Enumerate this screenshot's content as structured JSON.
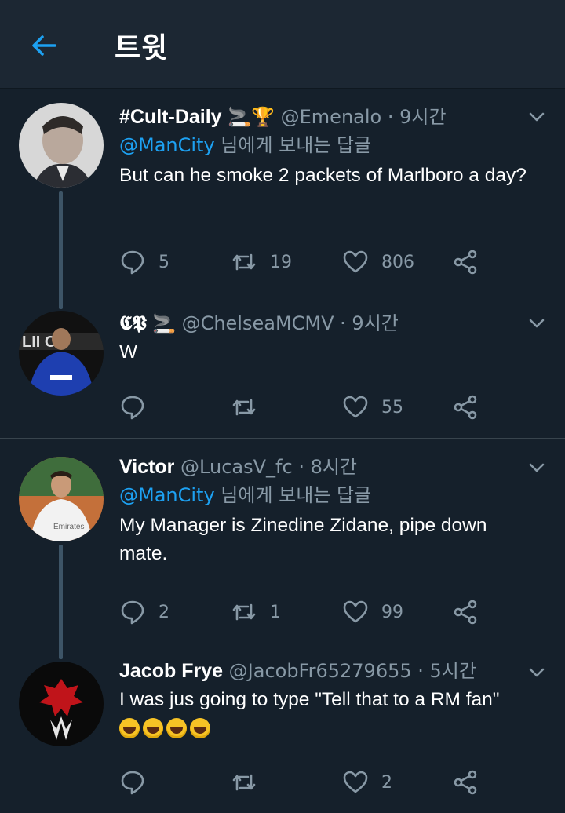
{
  "header": {
    "title": "트윗"
  },
  "tweets": [
    {
      "name": "#Cult-Daily",
      "name_emoji": "🚬🏆",
      "handle": "@Emenalo",
      "time": "9시간",
      "reply_mention": "@ManCity",
      "reply_suffix": " 님에게 보내는 답글",
      "text": "But can he smoke 2 packets of Marlboro a day?",
      "replies": "5",
      "retweets": "19",
      "likes": "806"
    },
    {
      "name": "𝕮𝕻",
      "name_emoji": "🚬",
      "handle": "@ChelseaMCMV",
      "time": "9시간",
      "text": "W",
      "likes": "55"
    },
    {
      "name": "Victor",
      "handle": "@LucasV_fc",
      "time": "8시간",
      "reply_mention": "@ManCity",
      "reply_suffix": " 님에게 보내는 답글",
      "text": "My Manager is Zinedine Zidane, pipe down mate.",
      "replies": "2",
      "retweets": "1",
      "likes": "99"
    },
    {
      "name": "Jacob Frye",
      "handle": "@JacobFr65279655",
      "time": "5시간",
      "text": "I was jus going to type \"Tell that to a RM fan\"",
      "likes": "2"
    }
  ],
  "separator": " · ",
  "colors": {
    "background": "#15202b",
    "accent": "#1da1f2",
    "muted": "#8899a6"
  },
  "icons": [
    "back-arrow-icon",
    "chevron-down-icon",
    "reply-icon",
    "retweet-icon",
    "like-icon",
    "share-icon",
    "laughing-emoji-icon"
  ]
}
